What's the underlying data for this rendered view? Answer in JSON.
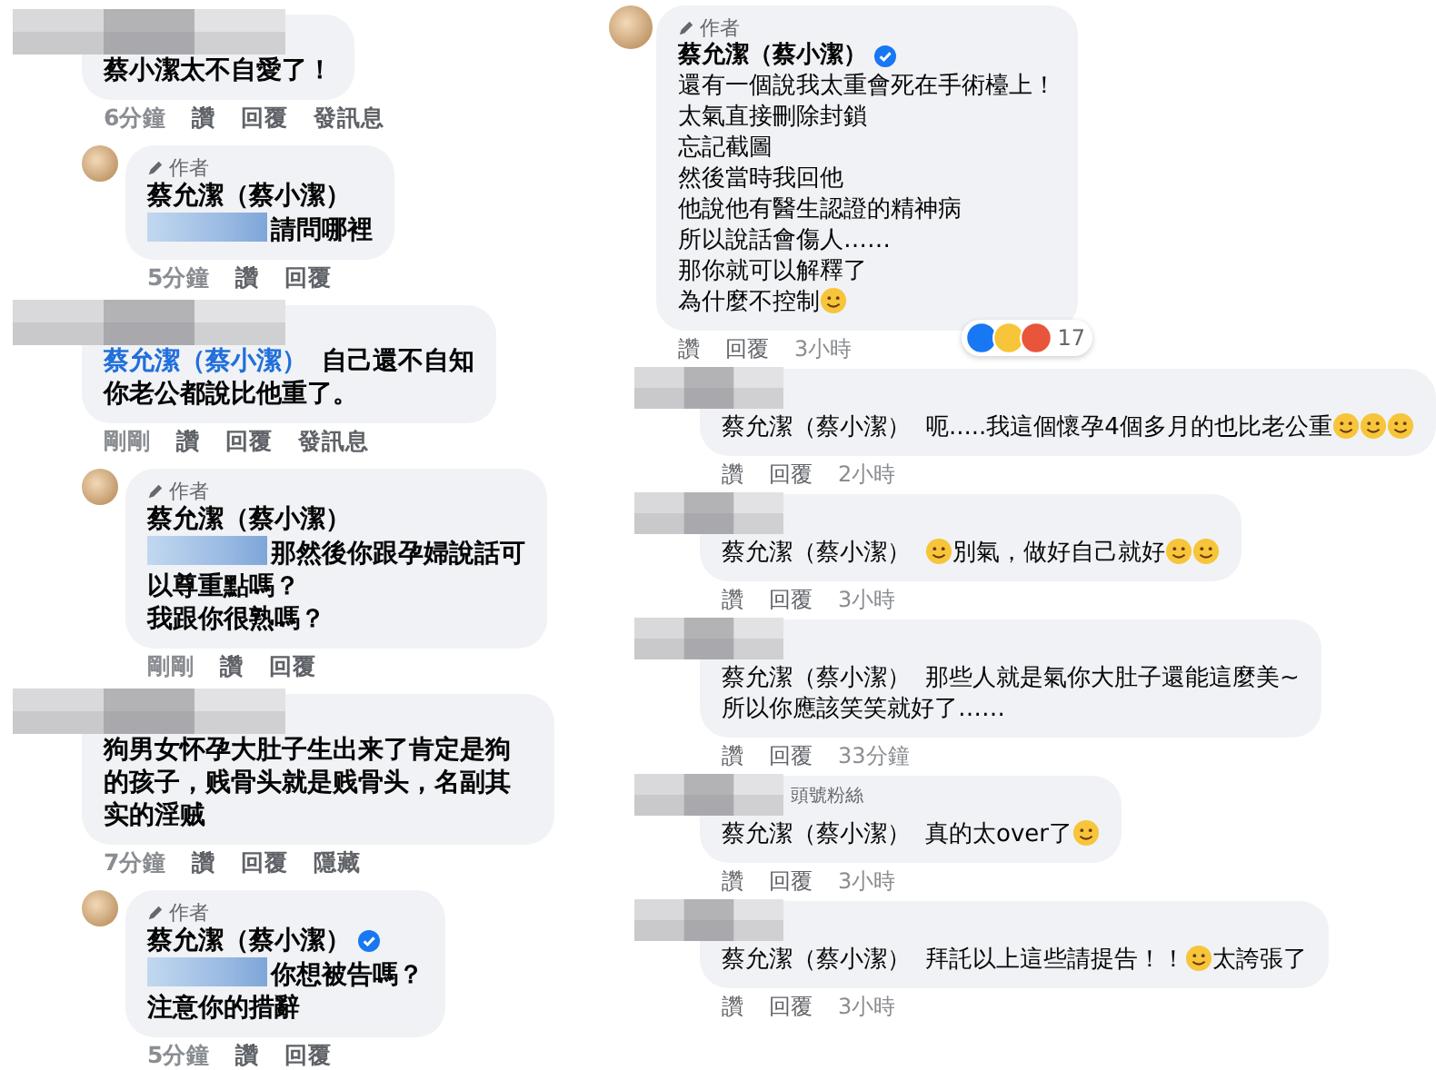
{
  "columns": [
    {
      "comments": [
        {
          "kind": "top",
          "name_redacted": true,
          "body": [
            [
              {
                "kind": "text",
                "text": "蔡小潔太不自愛了！"
              }
            ]
          ],
          "meta": [
            {
              "kind": "time",
              "text": "6分鐘"
            },
            {
              "kind": "action",
              "text": "讚"
            },
            {
              "kind": "action",
              "text": "回覆"
            },
            {
              "kind": "action",
              "text": "發訊息"
            }
          ]
        },
        {
          "kind": "reply",
          "author_label": "作者",
          "name": "蔡允潔（蔡小潔）",
          "verified": false,
          "body": [
            [
              {
                "kind": "redacted"
              },
              {
                "kind": "text",
                "text": "請問哪裡"
              }
            ]
          ],
          "meta": [
            {
              "kind": "time",
              "text": "5分鐘"
            },
            {
              "kind": "action",
              "text": "讚"
            },
            {
              "kind": "action",
              "text": "回覆"
            }
          ]
        },
        {
          "kind": "top",
          "name_redacted": true,
          "body": [
            [
              {
                "kind": "mention",
                "text": "蔡允潔（蔡小潔）",
                "link": true
              },
              {
                "kind": "text",
                "text": "自己還不自知"
              }
            ],
            [
              {
                "kind": "text",
                "text": "你老公都說比他重了。"
              }
            ]
          ],
          "meta": [
            {
              "kind": "time",
              "text": "剛剛"
            },
            {
              "kind": "action",
              "text": "讚"
            },
            {
              "kind": "action",
              "text": "回覆"
            },
            {
              "kind": "action",
              "text": "發訊息"
            }
          ]
        },
        {
          "kind": "reply",
          "author_label": "作者",
          "name": "蔡允潔（蔡小潔）",
          "verified": false,
          "body": [
            [
              {
                "kind": "redacted"
              },
              {
                "kind": "text",
                "text": "那然後你跟孕婦說話可"
              }
            ],
            [
              {
                "kind": "text",
                "text": "以尊重點嗎？"
              }
            ],
            [
              {
                "kind": "text",
                "text": "我跟你很熟嗎？"
              }
            ]
          ],
          "meta": [
            {
              "kind": "time",
              "text": "剛剛"
            },
            {
              "kind": "action",
              "text": "讚"
            },
            {
              "kind": "action",
              "text": "回覆"
            }
          ]
        },
        {
          "kind": "top",
          "name_redacted": true,
          "body": [
            [
              {
                "kind": "text",
                "text": "狗男女怀孕大肚子生出来了肯定是狗的孩子，贱骨头就是贱骨头，名副其实的淫贼"
              }
            ]
          ],
          "meta": [
            {
              "kind": "time",
              "text": "7分鐘"
            },
            {
              "kind": "action",
              "text": "讚"
            },
            {
              "kind": "action",
              "text": "回覆"
            },
            {
              "kind": "action",
              "text": "隱藏"
            }
          ]
        },
        {
          "kind": "reply",
          "author_label": "作者",
          "name": "蔡允潔（蔡小潔）",
          "verified": true,
          "body": [
            [
              {
                "kind": "redacted"
              },
              {
                "kind": "text",
                "text": "你想被告嗎？"
              }
            ],
            [
              {
                "kind": "text",
                "text": "注意你的措辭"
              }
            ]
          ],
          "meta": [
            {
              "kind": "time",
              "text": "5分鐘"
            },
            {
              "kind": "action",
              "text": "讚"
            },
            {
              "kind": "action",
              "text": "回覆"
            }
          ]
        }
      ]
    },
    {
      "comments": [
        {
          "kind": "reply",
          "author_label": "作者",
          "name": "蔡允潔（蔡小潔）",
          "verified": true,
          "body": [
            [
              {
                "kind": "text",
                "text": "還有一個說我太重會死在手術檯上！"
              }
            ],
            [
              {
                "kind": "text",
                "text": "太氣直接刪除封鎖"
              }
            ],
            [
              {
                "kind": "text",
                "text": "忘記截圖"
              }
            ],
            [
              {
                "kind": "text",
                "text": "然後當時我回他"
              }
            ],
            [
              {
                "kind": "text",
                "text": "他說他有醫生認證的精神病"
              }
            ],
            [
              {
                "kind": "text",
                "text": "所以說話會傷人……"
              }
            ],
            [
              {
                "kind": "text",
                "text": "那你就可以解釋了"
              }
            ],
            [
              {
                "kind": "text",
                "text": "為什麼不控制"
              },
              {
                "kind": "emoji"
              }
            ]
          ],
          "reactions": {
            "icons": [
              {
                "kind": "like"
              },
              {
                "kind": "wow"
              },
              {
                "kind": "angry"
              }
            ],
            "count": "17"
          },
          "meta": [
            {
              "kind": "action",
              "text": "讚"
            },
            {
              "kind": "action",
              "text": "回覆"
            },
            {
              "kind": "time",
              "text": "3小時"
            }
          ]
        },
        {
          "kind": "top",
          "name_redacted": true,
          "body": [
            [
              {
                "kind": "mention",
                "text": "蔡允潔（蔡小潔）",
                "link": false
              },
              {
                "kind": "text",
                "text": "呃.....我這個懷孕4個多月的也比老公重"
              },
              {
                "kind": "emoji"
              },
              {
                "kind": "emoji"
              },
              {
                "kind": "emoji"
              }
            ]
          ],
          "meta": [
            {
              "kind": "action",
              "text": "讚"
            },
            {
              "kind": "action",
              "text": "回覆"
            },
            {
              "kind": "time",
              "text": "2小時"
            }
          ]
        },
        {
          "kind": "top",
          "name_redacted": true,
          "body": [
            [
              {
                "kind": "mention",
                "text": "蔡允潔（蔡小潔）",
                "link": false
              },
              {
                "kind": "emoji"
              },
              {
                "kind": "text",
                "text": "別氣，做好自己就好"
              },
              {
                "kind": "emoji"
              },
              {
                "kind": "emoji"
              }
            ]
          ],
          "meta": [
            {
              "kind": "action",
              "text": "讚"
            },
            {
              "kind": "action",
              "text": "回覆"
            },
            {
              "kind": "time",
              "text": "3小時"
            }
          ]
        },
        {
          "kind": "top",
          "name_redacted": true,
          "body": [
            [
              {
                "kind": "mention",
                "text": "蔡允潔（蔡小潔）",
                "link": false
              },
              {
                "kind": "text",
                "text": "那些人就是氣你大肚子還能這麼美~"
              }
            ],
            [
              {
                "kind": "text",
                "text": "所以你應該笑笑就好了……"
              }
            ]
          ],
          "meta": [
            {
              "kind": "action",
              "text": "讚"
            },
            {
              "kind": "action",
              "text": "回覆"
            },
            {
              "kind": "time",
              "text": "33分鐘"
            }
          ]
        },
        {
          "kind": "top",
          "name_redacted": true,
          "badge": "頭號粉絲",
          "body": [
            [
              {
                "kind": "mention",
                "text": "蔡允潔（蔡小潔）",
                "link": false
              },
              {
                "kind": "text",
                "text": "真的太over了"
              },
              {
                "kind": "emoji"
              }
            ]
          ],
          "meta": [
            {
              "kind": "action",
              "text": "讚"
            },
            {
              "kind": "action",
              "text": "回覆"
            },
            {
              "kind": "time",
              "text": "3小時"
            }
          ]
        },
        {
          "kind": "top",
          "name_redacted": true,
          "body": [
            [
              {
                "kind": "mention",
                "text": "蔡允潔（蔡小潔）",
                "link": false
              },
              {
                "kind": "text",
                "text": "拜託以上這些請提告！！"
              },
              {
                "kind": "emoji"
              },
              {
                "kind": "text",
                "text": "太誇張了"
              }
            ]
          ],
          "meta": [
            {
              "kind": "action",
              "text": "讚"
            },
            {
              "kind": "action",
              "text": "回覆"
            },
            {
              "kind": "time",
              "text": "3小時"
            }
          ]
        }
      ]
    }
  ]
}
